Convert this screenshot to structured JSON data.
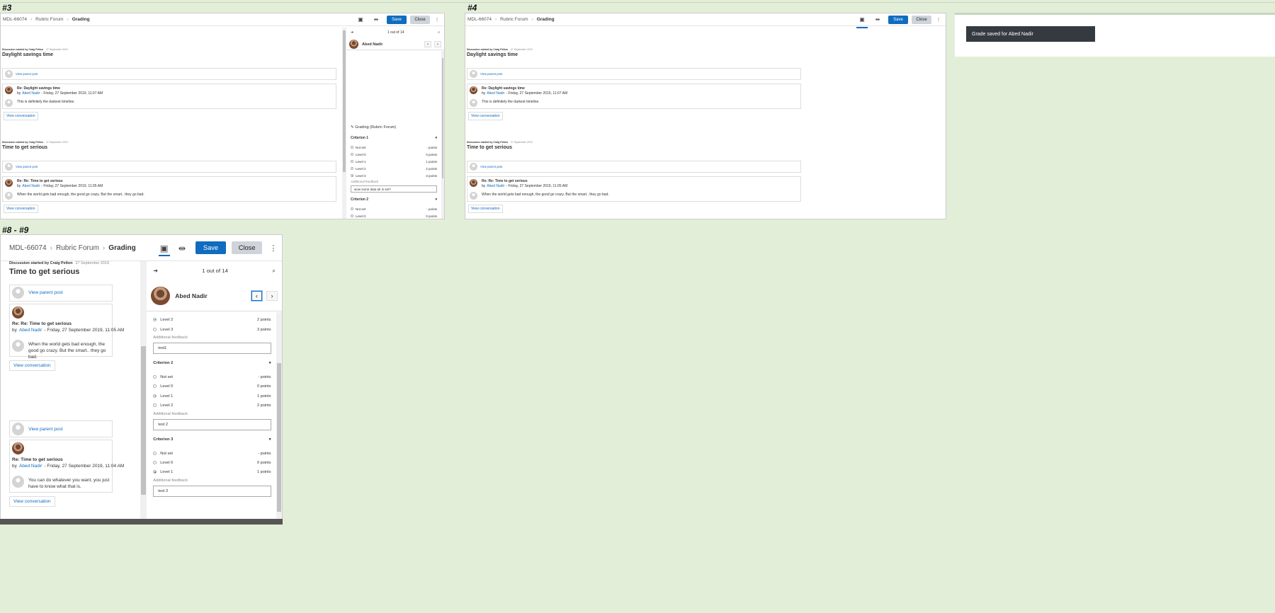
{
  "labels": {
    "s3": "#3",
    "s4": "#4",
    "s8": "#8 - #9"
  },
  "breadcrumb": {
    "course": "MDL-66074",
    "forum": "Rubric Forum",
    "current": "Grading"
  },
  "actions": {
    "save": "Save",
    "close": "Close",
    "more": "⋮"
  },
  "pager": {
    "text": "1 out of 14"
  },
  "user": {
    "name": "Abed Nadir"
  },
  "grading_heading": "Grading (Rubric Forum)",
  "toast": "Grade saved for Abed Nadir",
  "discussions": [
    {
      "started_by": "Discussion started by Craig Pelton",
      "date": "27 September 2019",
      "title": "Daylight savings time",
      "parent_link": "View parent post",
      "reply_title": "Re: Daylight savings time",
      "by": "by",
      "author": "Abed Nadir",
      "reply_date": "- Friday, 27 September 2019, 11:07 AM",
      "body": "This is definitely the darkest timeline.",
      "view_conv": "View conversation"
    },
    {
      "started_by": "Discussion started by Craig Pelton",
      "date": "27 September 2019",
      "title": "Time to get serious",
      "parent_link": "View parent post",
      "reply_title": "Re: Re: Time to get serious",
      "by": "by",
      "author": "Abed Nadir",
      "reply_date": "- Friday, 27 September 2019, 11:05 AM",
      "body": "When the world gets bad enough, the good go crazy. But the smart.. they go bad.",
      "view_conv": "View conversation"
    },
    {
      "parent_link": "View parent post",
      "reply_title": "Re: Time to get serious",
      "by": "by",
      "author": "Abed Nadir",
      "reply_date": "- Friday, 27 September 2019, 11:04 AM",
      "body": "You can do whatever you want, you just have to know what that is.",
      "view_conv": "View conversation"
    }
  ],
  "rubric": {
    "feedback_label": "Additional feedback",
    "criteria": [
      {
        "name": "Criterion 1",
        "levels": [
          [
            "Not set",
            "- points"
          ],
          [
            "Level 0",
            "0 points"
          ],
          [
            "Level 1",
            "1 points"
          ],
          [
            "Level 2",
            "2 points"
          ],
          [
            "Level 3",
            "3 points"
          ]
        ]
      },
      {
        "name": "Criterion 2",
        "levels": [
          [
            "Not set",
            "- points"
          ],
          [
            "Level 0",
            "0 points"
          ],
          [
            "Level 1",
            "1 points"
          ],
          [
            "Level 2",
            "2 points"
          ]
        ]
      },
      {
        "name": "Criterion 3",
        "levels": [
          [
            "Not set",
            "- points"
          ],
          [
            "Level 0",
            "0 points"
          ],
          [
            "Level 1",
            "1 points"
          ]
        ]
      }
    ]
  },
  "states": {
    "s3": {
      "selected": [
        4,
        3,
        null
      ],
      "feedback": [
        "wow some data alr is set?",
        "",
        ""
      ]
    },
    "s4": {
      "selected": [
        3,
        2,
        2
      ],
      "feedback": [
        "test1",
        "test 2",
        "test 3"
      ]
    },
    "s8": {
      "selected": [
        3,
        2,
        2
      ],
      "feedback": [
        "test1",
        "test 2",
        "test 3"
      ]
    }
  },
  "colors": {
    "accent": "#0f6cbf",
    "background": "#e3eed9",
    "toast": "#343a40"
  }
}
